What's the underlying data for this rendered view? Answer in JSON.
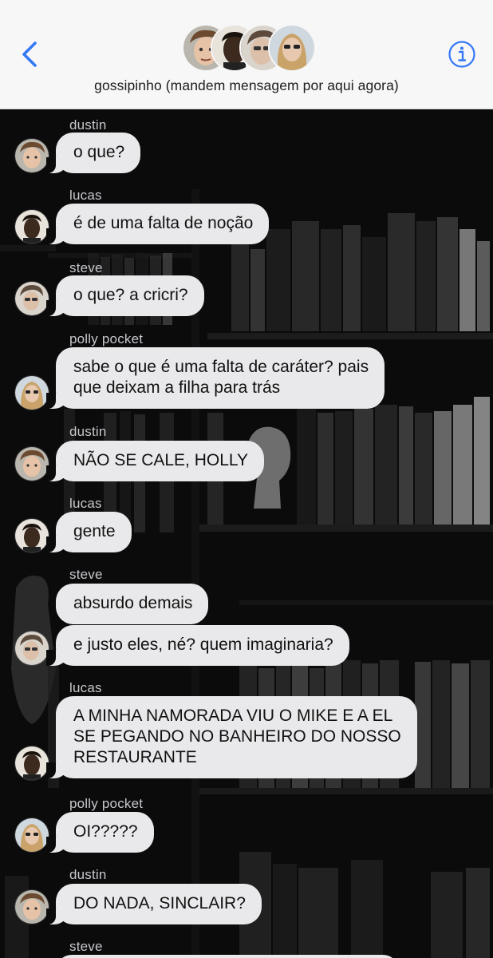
{
  "header": {
    "group_name": "gossipinho (mandem mensagem por aqui agora)",
    "back_icon": "chevron-left-icon",
    "info_icon": "info-circle-icon",
    "accent_color": "#3478f6",
    "participants": [
      "dustin",
      "lucas",
      "steve",
      "polly pocket"
    ]
  },
  "colors": {
    "bubble": "#e9e9eb",
    "sender_label": "#c7c7cc",
    "header_bg": "#f7f7f8"
  },
  "messages": [
    {
      "sender": "dustin",
      "text": "o que?"
    },
    {
      "sender": "lucas",
      "text": "é de uma falta de noção"
    },
    {
      "sender": "steve",
      "text": "o que? a cricri?"
    },
    {
      "sender": "polly pocket",
      "lines": [
        "sabe o que é uma falta de caráter? pais",
        "que deixam a filha para trás"
      ]
    },
    {
      "sender": "dustin",
      "text": "NÃO SE CALE, HOLLY"
    },
    {
      "sender": "lucas",
      "text": "gente"
    },
    {
      "sender": "steve",
      "text": "absurdo demais"
    },
    {
      "sender": "steve",
      "text": "e justo eles, né? quem imaginaria?"
    },
    {
      "sender": "lucas",
      "lines": [
        "A MINHA NAMORADA VIU O MIKE E A EL",
        "SE PEGANDO NO BANHEIRO DO NOSSO",
        "RESTAURANTE"
      ]
    },
    {
      "sender": "polly pocket",
      "text": "OI?????"
    },
    {
      "sender": "dustin",
      "text": "DO NADA, SINCLAIR?"
    },
    {
      "sender": "steve",
      "text": ""
    }
  ]
}
